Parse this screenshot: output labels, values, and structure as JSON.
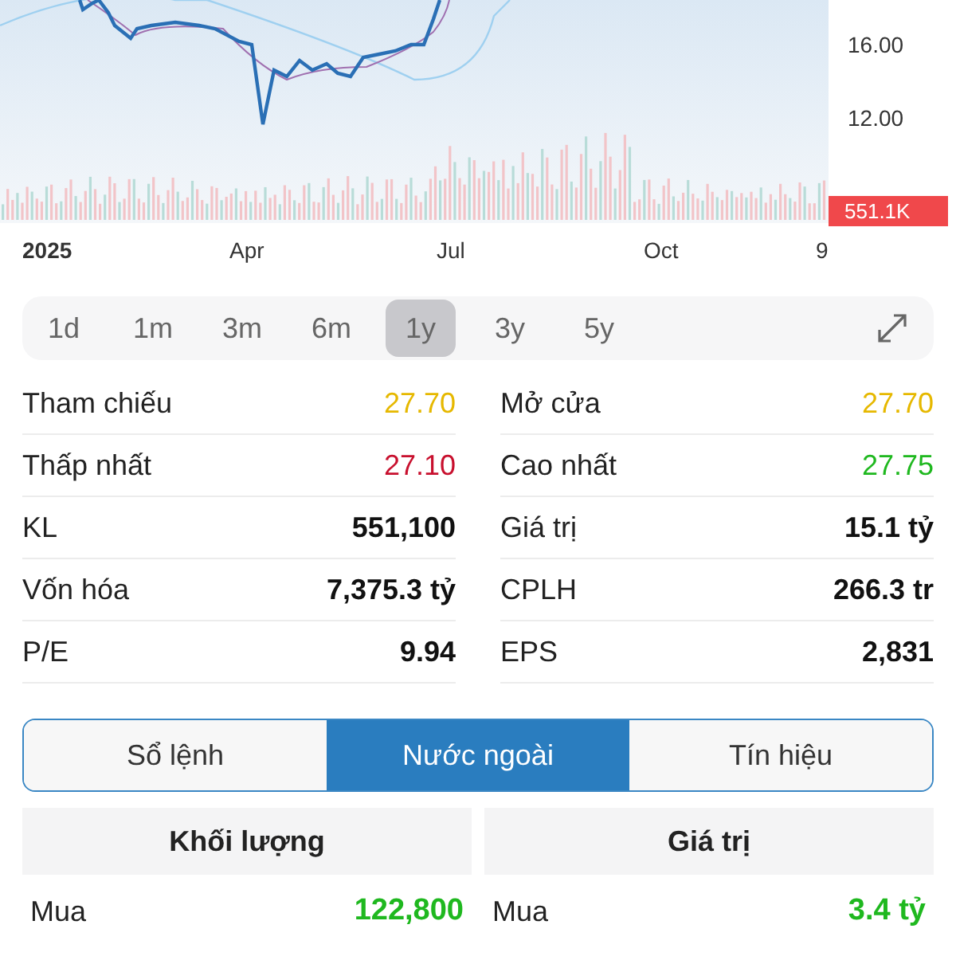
{
  "chart": {
    "y_ticks": [
      "16.00",
      "12.00"
    ],
    "volume_badge": "551.1K",
    "x_labels": [
      {
        "label": "2025",
        "kind": "year"
      },
      {
        "label": "Apr",
        "kind": "month"
      },
      {
        "label": "Jul",
        "kind": "month"
      },
      {
        "label": "Oct",
        "kind": "month"
      },
      {
        "label": "9",
        "kind": "month"
      }
    ]
  },
  "periods": [
    {
      "label": "1d",
      "selected": false
    },
    {
      "label": "1m",
      "selected": false
    },
    {
      "label": "3m",
      "selected": false
    },
    {
      "label": "6m",
      "selected": false
    },
    {
      "label": "1y",
      "selected": true
    },
    {
      "label": "3y",
      "selected": false
    },
    {
      "label": "5y",
      "selected": false
    }
  ],
  "stats": [
    {
      "label": "Tham chiếu",
      "value": "27.70",
      "kind": "price",
      "color": "#e6b800"
    },
    {
      "label": "Mở cửa",
      "value": "27.70",
      "kind": "price",
      "color": "#e6b800"
    },
    {
      "label": "Thấp nhất",
      "value": "27.10",
      "kind": "price",
      "color": "#c8102e"
    },
    {
      "label": "Cao nhất",
      "value": "27.75",
      "kind": "price",
      "color": "#1fb81f"
    },
    {
      "label": "KL",
      "value": "551,100",
      "kind": "figure"
    },
    {
      "label": "Giá trị",
      "value": "15.1 tỷ",
      "kind": "figure"
    },
    {
      "label": "Vốn hóa",
      "value": "7,375.3 tỷ",
      "kind": "figure"
    },
    {
      "label": "CPLH",
      "value": "266.3 tr",
      "kind": "figure"
    },
    {
      "label": "P/E",
      "value": "9.94",
      "kind": "figure"
    },
    {
      "label": "EPS",
      "value": "2,831",
      "kind": "figure"
    }
  ],
  "tabs": [
    {
      "label": "Sổ lệnh",
      "selected": false
    },
    {
      "label": "Nước ngoài",
      "selected": true
    },
    {
      "label": "Tín hiệu",
      "selected": false
    }
  ],
  "foreign": [
    {
      "heading": "Khối lượng",
      "rows": [
        {
          "label": "Mua",
          "value": "122,800",
          "color": "#1fb81f"
        }
      ]
    },
    {
      "heading": "Giá trị",
      "rows": [
        {
          "label": "Mua",
          "value": "3.4 tỷ",
          "color": "#1fb81f"
        }
      ]
    }
  ]
}
